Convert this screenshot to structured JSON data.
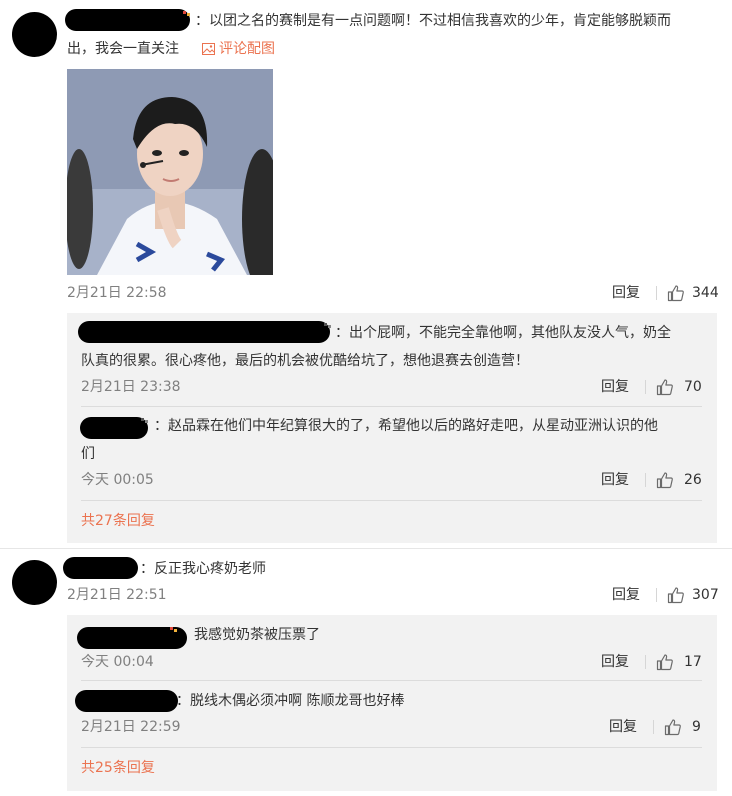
{
  "comments": [
    {
      "text_line1": "：以团之名的赛制是有一点问题啊！不过相信我喜欢的少年，肯定能够脱颖而",
      "text_line2": "出，我会一直关注",
      "image_link": "评论配图",
      "time": "2月21日 22:58",
      "reply_label": "回复",
      "likes": "344",
      "replies": [
        {
          "text_line1": "：出个屁啊，不能完全靠他啊，其他队友没人气，奶全",
          "text_line2": "队真的很累。很心疼他，最后的机会被优酷给坑了，想他退赛去创造营！",
          "time": "2月21日 23:38",
          "reply_label": "回复",
          "likes": "70"
        },
        {
          "text_line1": "：赵品霖在他们中年纪算很大的了，希望他以后的路好走吧，从星动亚洲认识的他",
          "text_line2": "们",
          "time": "今天 00:05",
          "reply_label": "回复",
          "likes": "26"
        }
      ],
      "more_replies": "共27条回复"
    },
    {
      "text_line1": "：反正我心疼奶老师",
      "time": "2月21日 22:51",
      "reply_label": "回复",
      "likes": "307",
      "replies": [
        {
          "text_line1": "我感觉奶茶被压票了",
          "time": "今天 00:04",
          "reply_label": "回复",
          "likes": "17"
        },
        {
          "text_line1": "：脱线木偶必须冲啊 陈顺龙哥也好棒",
          "time": "2月21日 22:59",
          "reply_label": "回复",
          "likes": "9"
        }
      ],
      "more_replies": "共25条回复"
    }
  ],
  "icons": {
    "like": "thumbs-up-icon",
    "image": "image-icon"
  },
  "colors": {
    "link": "#eb7350",
    "reply_bg": "#f2f2f2",
    "muted": "#808080"
  }
}
